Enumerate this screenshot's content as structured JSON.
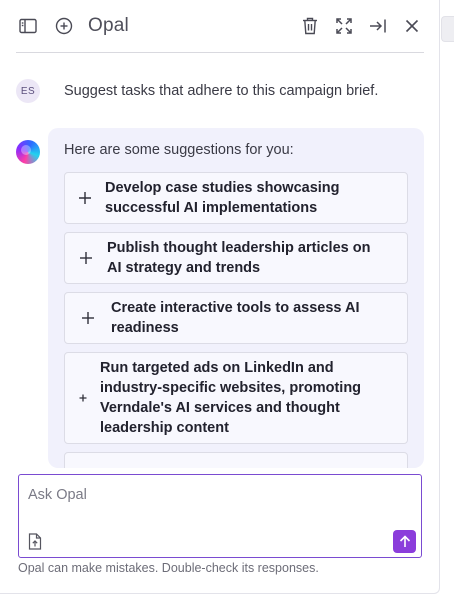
{
  "header": {
    "title": "Opal",
    "icons": [
      "sidebar-toggle-icon",
      "new-chat-icon",
      "trash-icon",
      "expand-icon",
      "collapse-to-right-icon",
      "close-icon"
    ]
  },
  "conversation": {
    "user": {
      "initials": "ES",
      "message": "Suggest tasks that adhere to this campaign brief."
    },
    "assistant": {
      "intro": "Here are some suggestions for you:",
      "suggestions": [
        {
          "line1": "Develop case studies showcasing",
          "line2": "successful AI implementations"
        },
        {
          "line1": "Publish thought leadership articles on",
          "line2": "AI strategy and trends"
        },
        {
          "line1": "Create interactive tools to assess AI",
          "line2": "readiness"
        },
        {
          "line1": "Run targeted ads on LinkedIn and",
          "line2": "industry-specific websites, promoting",
          "line3": "Verndale's AI services and thought",
          "line4": "leadership content"
        }
      ]
    }
  },
  "composer": {
    "placeholder": "Ask Opal",
    "disclaimer": "Opal can make mistakes. Double-check its responses."
  },
  "colors": {
    "accent": "#8b3ddb",
    "bubble": "#f1f1fc",
    "input_border": "#7a4bd1"
  }
}
